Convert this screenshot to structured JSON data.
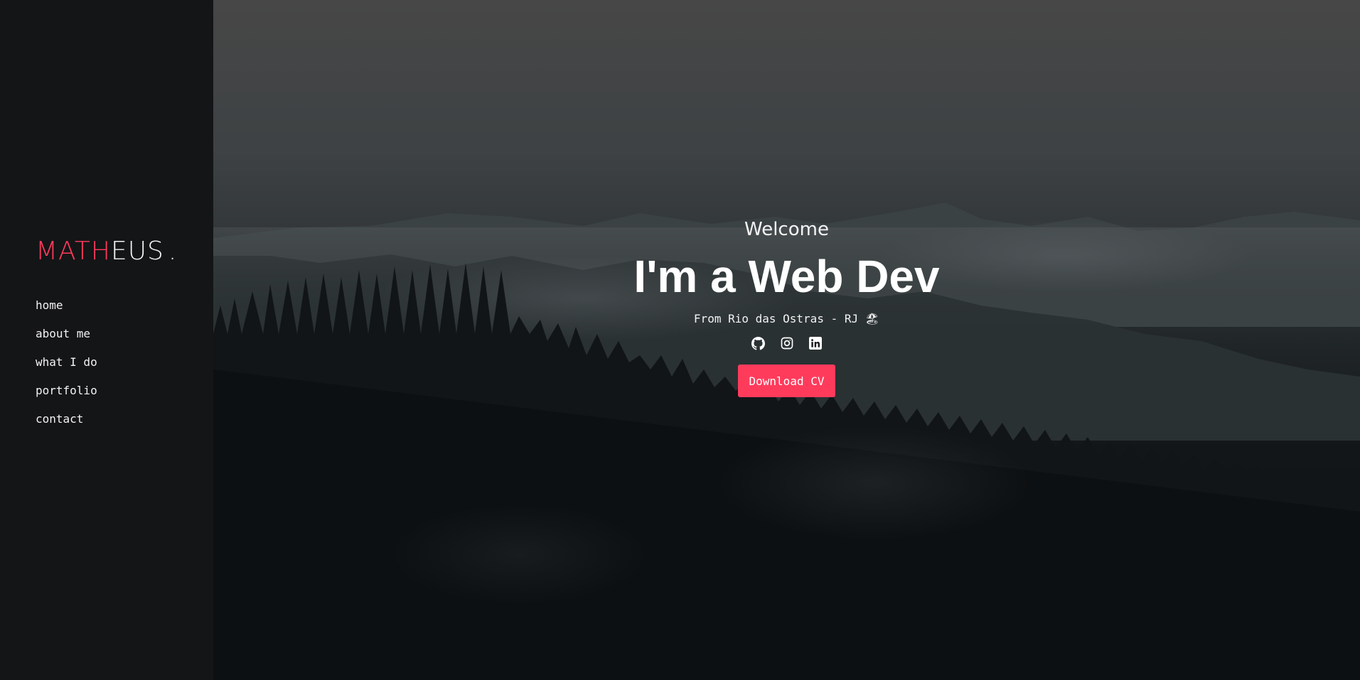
{
  "sidebar": {
    "logo": {
      "accent": "MATH",
      "rest": "EUS",
      "dot": "."
    },
    "nav": [
      {
        "label": "home"
      },
      {
        "label": "about me"
      },
      {
        "label": "what I do"
      },
      {
        "label": "portfolio"
      },
      {
        "label": "contact"
      }
    ]
  },
  "hero": {
    "welcome": "Welcome",
    "title": "I'm a Web Dev",
    "subtitle": "From Rio das Ostras - RJ 🏖",
    "socials": [
      {
        "icon": "github-icon"
      },
      {
        "icon": "instagram-icon"
      },
      {
        "icon": "linkedin-icon"
      }
    ],
    "cta_label": "Download CV"
  },
  "colors": {
    "accent": "#ff3b5c",
    "sidebar_bg": "#141517",
    "text": "#f2f2f2"
  }
}
